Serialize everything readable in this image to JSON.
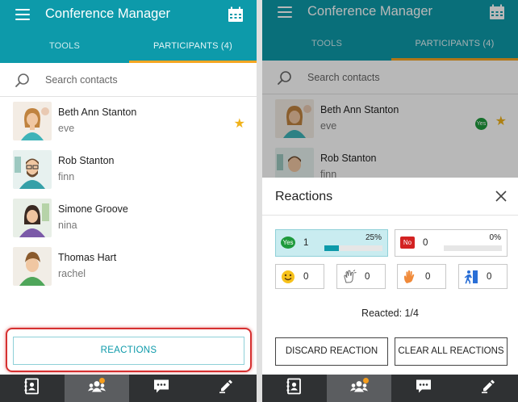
{
  "app": {
    "title": "Conference Manager"
  },
  "tabs": {
    "tools": "TOOLS",
    "participants": "PARTICIPANTS (4)"
  },
  "search": {
    "placeholder": "Search contacts"
  },
  "participants": [
    {
      "name": "Beth Ann Stanton",
      "username": "eve",
      "starred": true,
      "avatar": "woman-teal-avatar"
    },
    {
      "name": "Rob Stanton",
      "username": "finn",
      "starred": false,
      "avatar": "man-glasses-avatar"
    },
    {
      "name": "Simone Groove",
      "username": "nina",
      "starred": false,
      "avatar": "woman-purple-avatar"
    },
    {
      "name": "Thomas Hart",
      "username": "rachel",
      "starred": false,
      "avatar": "man-brown-avatar"
    }
  ],
  "reactions_button": "REACTIONS",
  "bottom_nav": [
    "contacts-icon",
    "participants-icon",
    "chat-icon",
    "edit-icon"
  ],
  "reactions_panel": {
    "title": "Reactions",
    "yes": {
      "label": "Yes",
      "count": "1",
      "percent": "25%",
      "fill": 0.25
    },
    "no": {
      "label": "No",
      "count": "0",
      "percent": "0%",
      "fill": 0
    },
    "emojis": [
      {
        "icon": "smile-icon",
        "count": "0"
      },
      {
        "icon": "clap-icon",
        "count": "0"
      },
      {
        "icon": "raise-hand-icon",
        "count": "0"
      },
      {
        "icon": "leave-icon",
        "count": "0"
      }
    ],
    "reacted": "Reacted: 1/4",
    "discard": "DISCARD REACTION",
    "clear_all": "CLEAR ALL REACTIONS"
  },
  "right_visible_participants": [
    {
      "name": "Beth Ann Stanton",
      "username": "eve",
      "reaction": "Yes",
      "starred": true
    },
    {
      "name": "Rob Stanton",
      "username": "finn"
    }
  ],
  "colors": {
    "primary": "#0d9aaa",
    "accent": "#f5a623",
    "bottom_bar": "#2f3133",
    "yes": "#1e9a3c",
    "no": "#d32222"
  }
}
